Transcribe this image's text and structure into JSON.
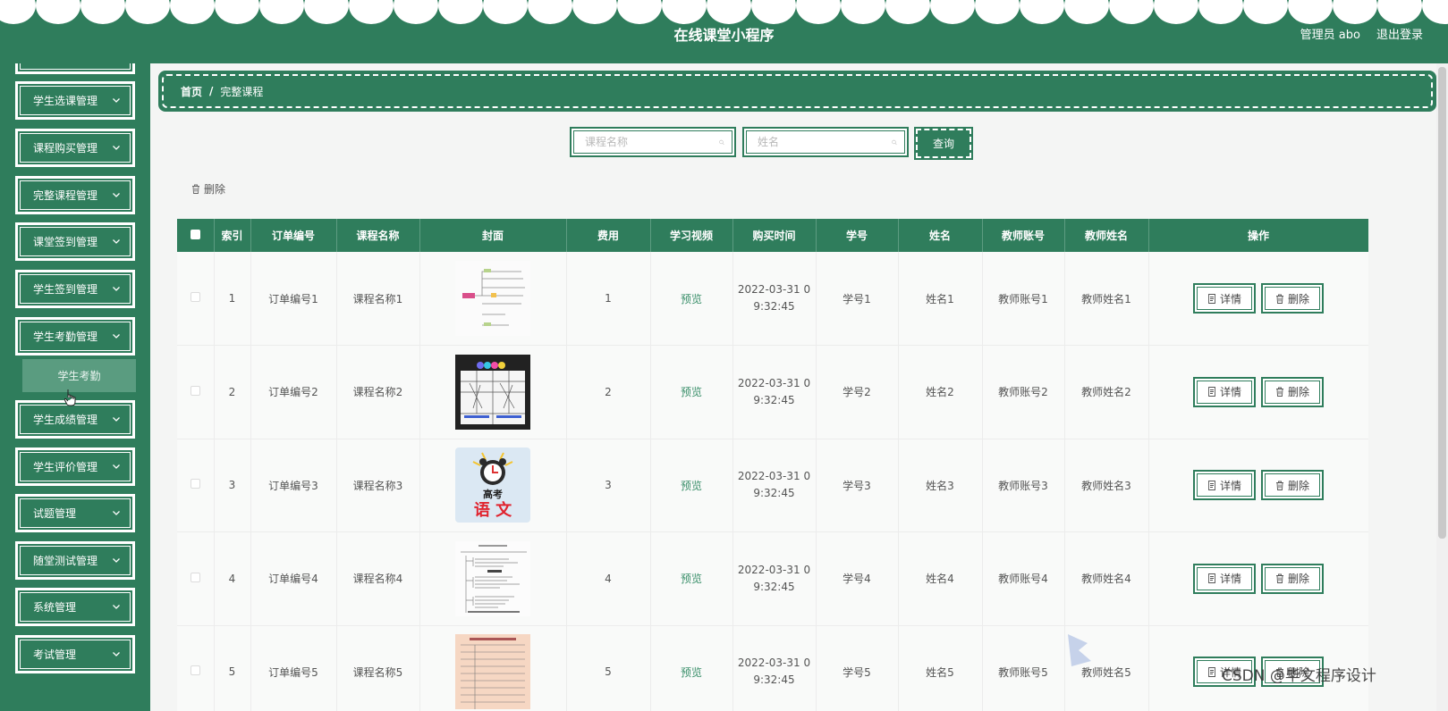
{
  "header": {
    "title": "在线课堂小程序",
    "user": "管理员 abo",
    "logout": "退出登录"
  },
  "sidebar": {
    "items": [
      {
        "label": "学生选课管理"
      },
      {
        "label": "课程购买管理"
      },
      {
        "label": "完整课程管理"
      },
      {
        "label": "课堂签到管理"
      },
      {
        "label": "学生签到管理"
      },
      {
        "label": "学生考勤管理"
      },
      {
        "label": "学生成绩管理"
      },
      {
        "label": "学生评价管理"
      },
      {
        "label": "试题管理"
      },
      {
        "label": "随堂测试管理"
      },
      {
        "label": "系统管理"
      },
      {
        "label": "考试管理"
      }
    ],
    "sub_item": "学生考勤"
  },
  "breadcrumb": {
    "home": "首页",
    "sep": "/",
    "current": "完整课程"
  },
  "search": {
    "course_placeholder": "课程名称",
    "name_placeholder": "姓名",
    "button": "查询"
  },
  "toolbar": {
    "delete": "删除"
  },
  "table": {
    "headers": [
      "索引",
      "订单编号",
      "课程名称",
      "封面",
      "费用",
      "学习视频",
      "购买时间",
      "学号",
      "姓名",
      "教师账号",
      "教师姓名",
      "操作"
    ],
    "rows": [
      {
        "index": "1",
        "order": "订单编号1",
        "course": "课程名称1",
        "fee": "1",
        "video": "预览",
        "time1": "2022-03-31 0",
        "time2": "9:32:45",
        "sid": "学号1",
        "name": "姓名1",
        "tacc": "教师账号1",
        "tname": "教师姓名1"
      },
      {
        "index": "2",
        "order": "订单编号2",
        "course": "课程名称2",
        "fee": "2",
        "video": "预览",
        "time1": "2022-03-31 0",
        "time2": "9:32:45",
        "sid": "学号2",
        "name": "姓名2",
        "tacc": "教师账号2",
        "tname": "教师姓名2"
      },
      {
        "index": "3",
        "order": "订单编号3",
        "course": "课程名称3",
        "fee": "3",
        "video": "预览",
        "time1": "2022-03-31 0",
        "time2": "9:32:45",
        "sid": "学号3",
        "name": "姓名3",
        "tacc": "教师账号3",
        "tname": "教师姓名3"
      },
      {
        "index": "4",
        "order": "订单编号4",
        "course": "课程名称4",
        "fee": "4",
        "video": "预览",
        "time1": "2022-03-31 0",
        "time2": "9:32:45",
        "sid": "学号4",
        "name": "姓名4",
        "tacc": "教师账号4",
        "tname": "教师姓名4"
      },
      {
        "index": "5",
        "order": "订单编号5",
        "course": "课程名称5",
        "fee": "5",
        "video": "预览",
        "time1": "2022-03-31 0",
        "time2": "9:32:45",
        "sid": "学号5",
        "name": "姓名5",
        "tacc": "教师账号5",
        "tname": "教师姓名5"
      }
    ],
    "detail_label": "详情",
    "delete_label": "删除",
    "cover3_text1": "高考",
    "cover3_text2": "语 文"
  },
  "watermark": "CSDN @毕文程序设计",
  "colors": {
    "primary": "#2f7d5c",
    "sub_item": "#5a9c80"
  }
}
